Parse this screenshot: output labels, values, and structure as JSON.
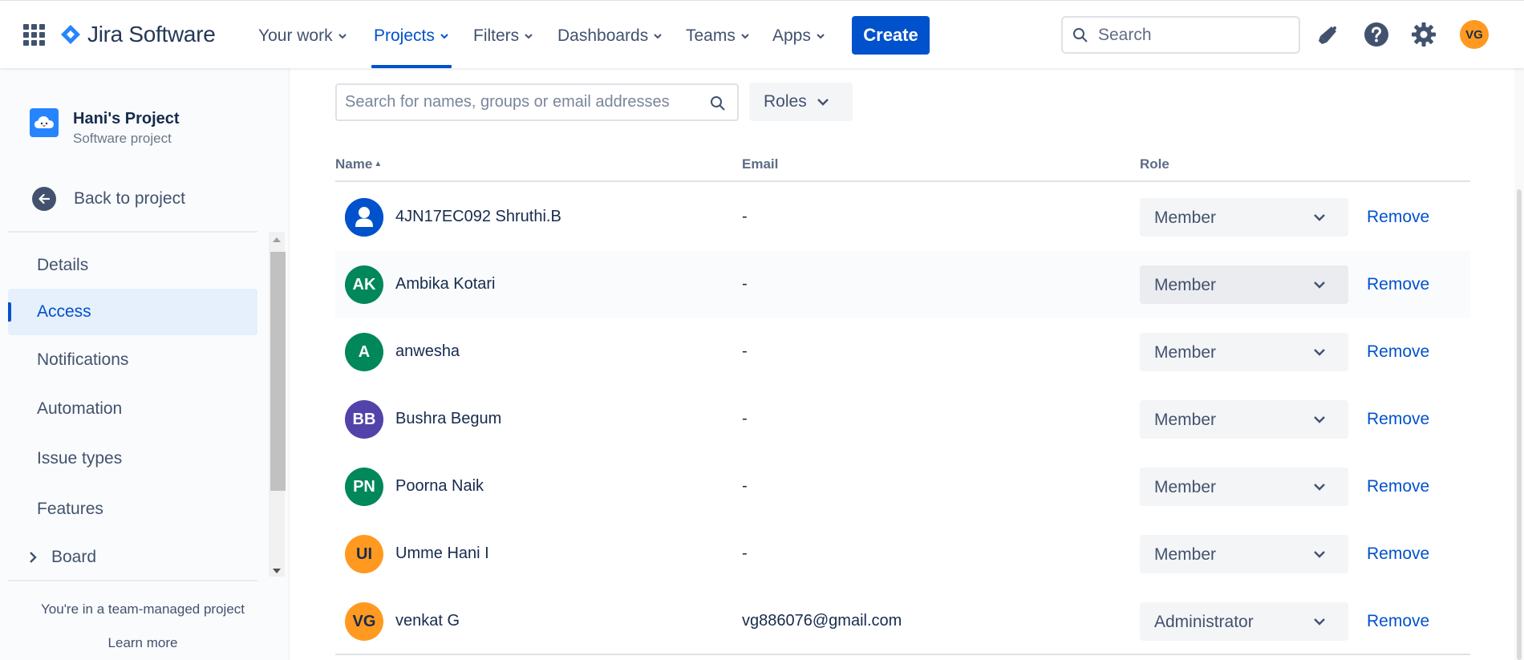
{
  "topnav": {
    "app_name": "Jira Software",
    "items": [
      {
        "label": "Your work",
        "active": false
      },
      {
        "label": "Projects",
        "active": true
      },
      {
        "label": "Filters",
        "active": false
      },
      {
        "label": "Dashboards",
        "active": false
      },
      {
        "label": "Teams",
        "active": false
      },
      {
        "label": "Apps",
        "active": false
      }
    ],
    "create_label": "Create",
    "search_placeholder": "Search",
    "user_initials": "VG",
    "icons": [
      "apps-grid-icon",
      "notification-megaphone-icon",
      "help-icon",
      "settings-gear-icon"
    ],
    "accent_color": "#0052cc"
  },
  "sidebar": {
    "project_name": "Hani's Project",
    "project_type": "Software project",
    "back_label": "Back to project",
    "items": [
      {
        "label": "Details",
        "active": false
      },
      {
        "label": "Access",
        "active": true
      },
      {
        "label": "Notifications",
        "active": false
      },
      {
        "label": "Automation",
        "active": false
      },
      {
        "label": "Issue types",
        "active": false
      },
      {
        "label": "Features",
        "active": false
      },
      {
        "label": "Board",
        "active": false,
        "expandable": true
      }
    ],
    "footer_note": "You're in a team-managed project",
    "learn_more": "Learn more"
  },
  "main": {
    "search_placeholder": "Search for names, groups or email addresses",
    "roles_filter_label": "Roles",
    "columns": {
      "name": "Name",
      "email": "Email",
      "role": "Role"
    },
    "remove_label": "Remove",
    "members": [
      {
        "initials": "",
        "name": "4JN17EC092 Shruthi.B",
        "email": "-",
        "role": "Member",
        "avatar_color": "#0052cc",
        "default_avatar": true
      },
      {
        "initials": "AK",
        "name": "Ambika Kotari",
        "email": "-",
        "role": "Member",
        "avatar_color": "#00875a"
      },
      {
        "initials": "A",
        "name": "anwesha",
        "email": "-",
        "role": "Member",
        "avatar_color": "#00875a"
      },
      {
        "initials": "BB",
        "name": "Bushra Begum",
        "email": "-",
        "role": "Member",
        "avatar_color": "#5243aa"
      },
      {
        "initials": "PN",
        "name": "Poorna Naik",
        "email": "-",
        "role": "Member",
        "avatar_color": "#00875a"
      },
      {
        "initials": "UI",
        "name": "Umme Hani I",
        "email": "-",
        "role": "Member",
        "avatar_color": "#ff991f"
      },
      {
        "initials": "VG",
        "name": "venkat G",
        "email": "vg886076@gmail.com",
        "role": "Administrator",
        "avatar_color": "#ff991f"
      }
    ]
  }
}
